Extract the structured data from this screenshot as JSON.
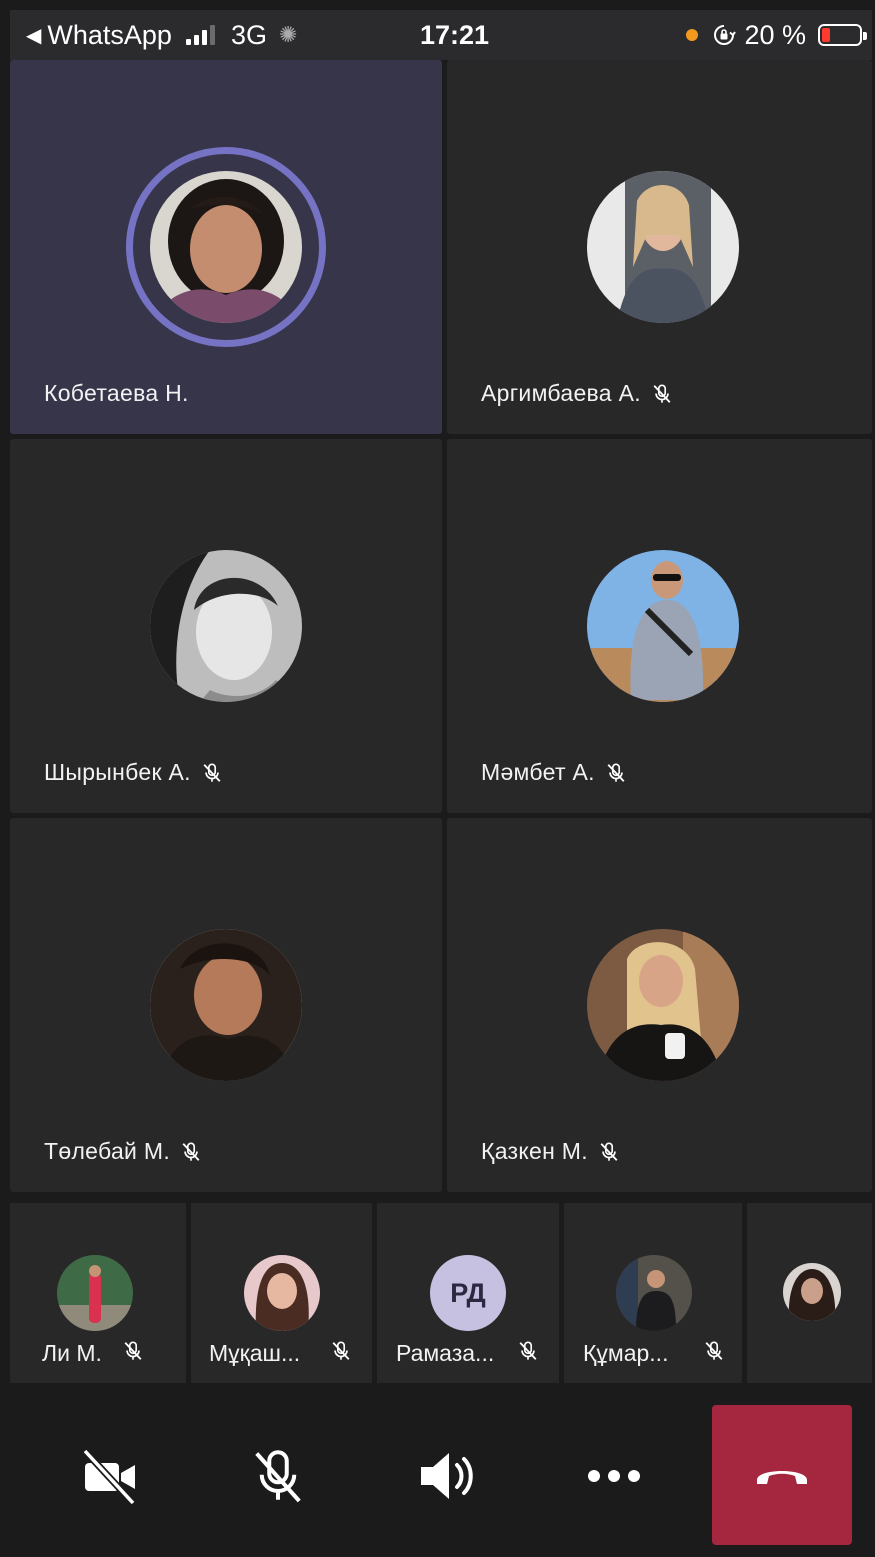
{
  "status_bar": {
    "back_app": "WhatsApp",
    "network": "3G",
    "time": "17:21",
    "battery_percent": "20 %",
    "battery_level": 0.2
  },
  "participants_main": [
    {
      "name": "Кобетаева Н.",
      "muted": false,
      "active_speaker": true,
      "avatar": "photo"
    },
    {
      "name": "Аргимбаева А.",
      "muted": true,
      "avatar": "photo"
    },
    {
      "name": "Шырынбек А.",
      "muted": true,
      "avatar": "photo"
    },
    {
      "name": "Мәмбет А.",
      "muted": true,
      "avatar": "photo"
    },
    {
      "name": "Төлебай М.",
      "muted": true,
      "avatar": "photo"
    },
    {
      "name": "Қазкен М.",
      "muted": true,
      "avatar": "photo"
    }
  ],
  "participants_strip": [
    {
      "name": "Ли М.",
      "muted": true,
      "avatar": "photo"
    },
    {
      "name": "Мұқаш...",
      "muted": true,
      "avatar": "photo"
    },
    {
      "name": "Рамаза...",
      "muted": true,
      "initials": "РД"
    },
    {
      "name": "Құмар...",
      "muted": true,
      "avatar": "photo"
    },
    {
      "name": "",
      "avatar": "photo"
    }
  ],
  "toolbar": {
    "camera": "camera-off-icon",
    "mic": "mic-off-icon",
    "speaker": "speaker-icon",
    "more": "more-icon",
    "hangup": "hang-up-icon"
  },
  "colors": {
    "background": "#1b1b1c",
    "tile": "#292829",
    "active_tile": "#36354a",
    "speaker_ring": "#7673c5",
    "hangup": "#a4263f",
    "battery_low": "#ff3b30"
  }
}
